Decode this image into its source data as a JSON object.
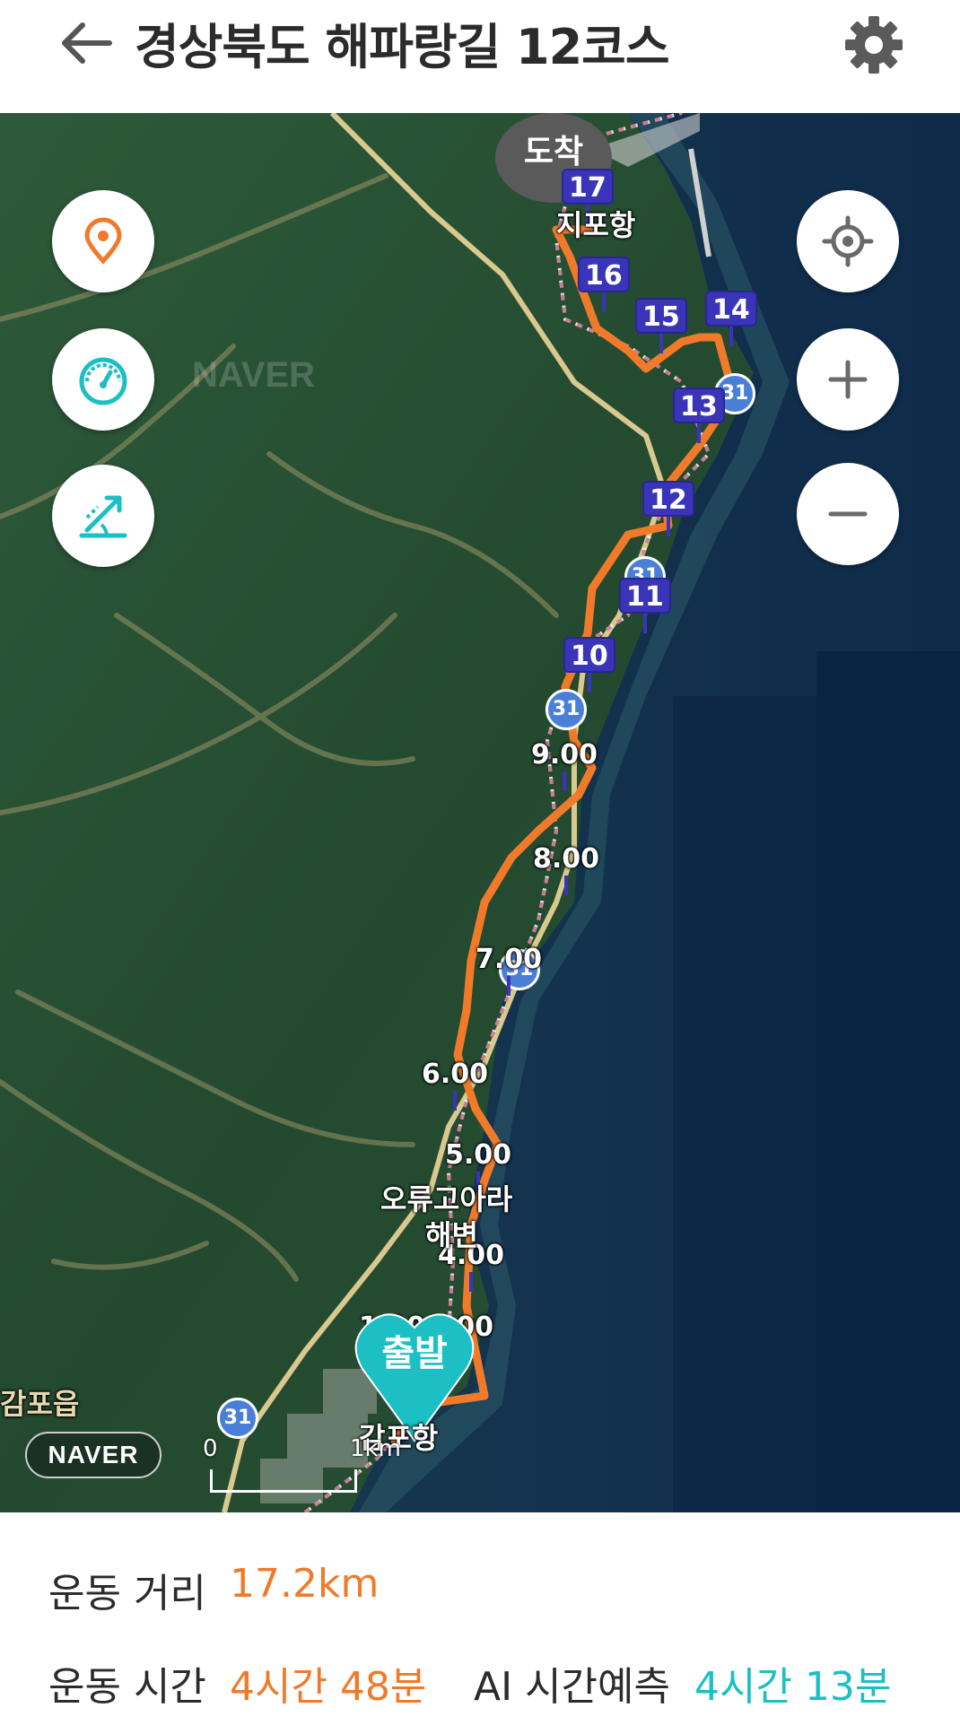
{
  "header": {
    "title": "경상북도 해파랑길 12코스"
  },
  "colors": {
    "route": "#f07a2a",
    "accent_orange": "#f07a2a",
    "accent_teal": "#1bbfc4",
    "marker": "#3a35b8"
  },
  "map": {
    "arrival_label": "도착",
    "start_label": "출발",
    "place_labels": {
      "end_port": "지포항",
      "beach_line1": "오류고아라",
      "beach_line2": "해변",
      "start_port": "감포항",
      "town": "감포읍"
    },
    "markers": {
      "m17": "17",
      "m16": "16",
      "m15": "15",
      "m14": "14",
      "m13": "13",
      "m12": "12",
      "m11": "11",
      "m10": "10",
      "m9": "9.00",
      "m8": "8.00",
      "m7": "7.00",
      "m6": "6.00",
      "m5": "5.00",
      "m4": "4.00",
      "m2": "2.00",
      "m1": "1.00"
    },
    "route_badges": {
      "b1": "31",
      "b2": "31",
      "b3": "31",
      "b4": "31",
      "b5": "31"
    },
    "scale": {
      "zero": "0",
      "unit": "1km"
    },
    "naver_logo": "NAVER",
    "naver_watermark": "NAVER",
    "controls": [
      "location-pin-icon",
      "speedometer-icon",
      "slope-icon",
      "my-location-icon",
      "zoom-in-icon",
      "zoom-out-icon"
    ]
  },
  "stats": {
    "distance_label": "운동 거리",
    "distance_value": "17.2km",
    "time_label": "운동 시간",
    "time_value": "4시간 48분",
    "ai_label": "AI 시간예측",
    "ai_value": "4시간 13분"
  }
}
